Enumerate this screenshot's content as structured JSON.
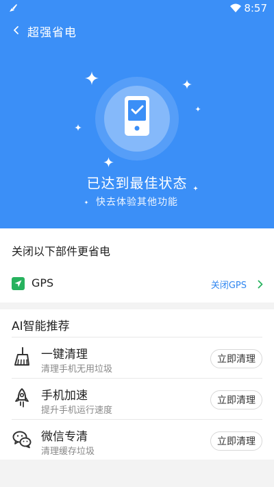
{
  "status_bar": {
    "time": "8:57"
  },
  "header": {
    "title": "超强省电"
  },
  "hero": {
    "status_title": "已达到最佳状态",
    "status_subtitle": "快去体验其他功能",
    "bg_color": "#3b8ff7"
  },
  "components": {
    "heading": "关闭以下部件更省电",
    "items": [
      {
        "label": "GPS",
        "action_label": "关闭GPS",
        "icon": "navigation-arrow-icon",
        "icon_color": "#27b25e"
      }
    ]
  },
  "ai": {
    "heading": "AI智能推荐",
    "items": [
      {
        "title": "一键清理",
        "description": "清理手机无用垃圾",
        "button_label": "立即清理",
        "icon": "broom-icon"
      },
      {
        "title": "手机加速",
        "description": "提升手机运行速度",
        "button_label": "立即清理",
        "icon": "rocket-icon"
      },
      {
        "title": "微信专清",
        "description": "清理缓存垃圾",
        "button_label": "立即清理",
        "icon": "wechat-icon"
      }
    ]
  }
}
